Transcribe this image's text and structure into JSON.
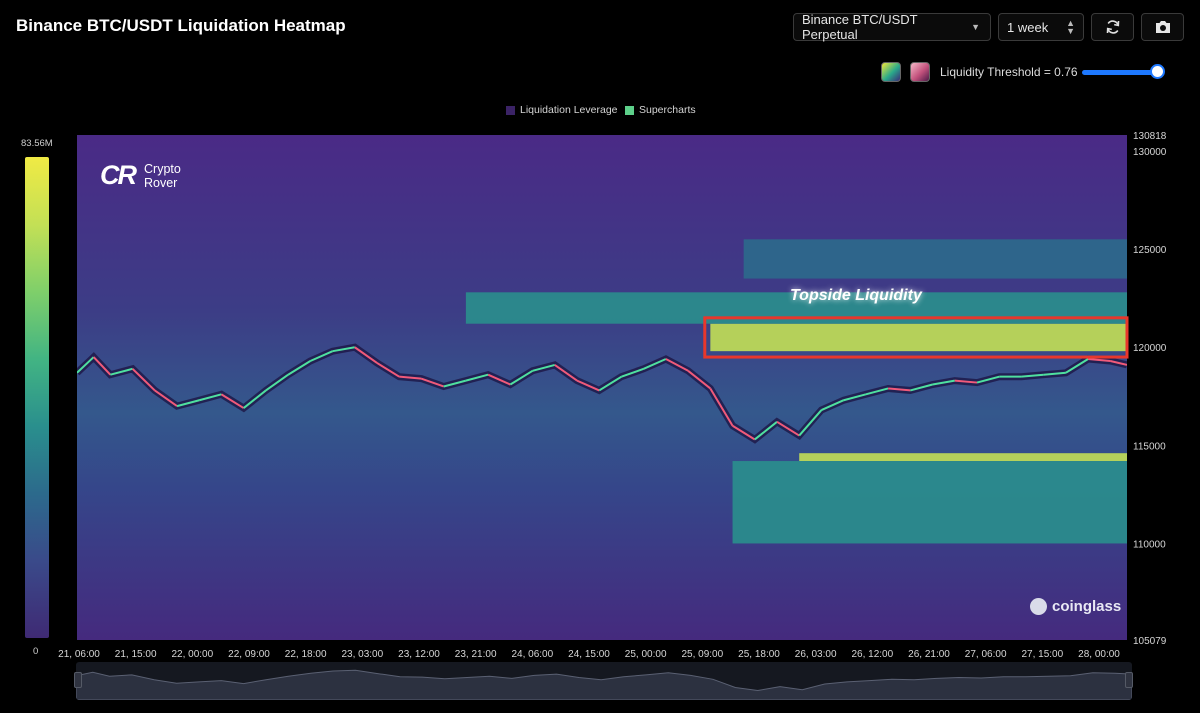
{
  "header": {
    "title": "Binance BTC/USDT Liquidation Heatmap",
    "market_select": "Binance BTC/USDT Perpetual",
    "range_select": "1 week",
    "refresh_icon": "refresh-icon",
    "camera_icon": "camera-icon"
  },
  "controls": {
    "swatch_1_colors": [
      "#f2e83a",
      "#2aa98a",
      "#3a2a78"
    ],
    "swatch_2_colors": [
      "#f6b8c8",
      "#c2517c",
      "#4c1a48"
    ],
    "threshold_label": "Liquidity Threshold = 0.76",
    "threshold_value": 0.76
  },
  "colorbar": {
    "max_label": "83.56M",
    "min_label": "0"
  },
  "branding": {
    "logo_mark": "CR",
    "logo_line1": "Crypto",
    "logo_line2": "Rover",
    "watermark": "coinglass"
  },
  "chart_data": {
    "type": "heatmap",
    "title": "Binance BTC/USDT Liquidation Heatmap",
    "legend": [
      "Liquidation Leverage",
      "Supercharts"
    ],
    "legend_colors": [
      "#3b2366",
      "#5dd08a"
    ],
    "legend_position": "top-center",
    "colorscale": [
      "#3f2a74",
      "#3a4a8a",
      "#2c6a8c",
      "#2a8f8d",
      "#42b483",
      "#7fcf6a",
      "#c3e055",
      "#f0ea44"
    ],
    "value_range": [
      0,
      83560000
    ],
    "x_tick_labels": [
      "21, 06:00",
      "21, 15:00",
      "22, 00:00",
      "22, 09:00",
      "22, 18:00",
      "23, 03:00",
      "23, 12:00",
      "23, 21:00",
      "24, 06:00",
      "24, 15:00",
      "25, 00:00",
      "25, 09:00",
      "25, 18:00",
      "26, 03:00",
      "26, 12:00",
      "26, 21:00",
      "27, 06:00",
      "27, 15:00",
      "28, 00:00"
    ],
    "x_range_hours": [
      0,
      189
    ],
    "y_tick_labels": [
      "130818",
      "130000",
      "125000",
      "120000",
      "115000",
      "110000",
      "105079"
    ],
    "ylim": [
      105079,
      130818
    ],
    "y_ticks": [
      130818,
      130000,
      125000,
      120000,
      115000,
      110000,
      105079
    ],
    "price_series": {
      "name": "BTC/USDT",
      "x_hours": [
        0,
        3,
        6,
        10,
        14,
        18,
        22,
        26,
        30,
        34,
        38,
        42,
        46,
        50,
        54,
        58,
        62,
        66,
        70,
        74,
        78,
        82,
        86,
        90,
        94,
        98,
        102,
        106,
        110,
        114,
        118,
        122,
        126,
        130,
        134,
        138,
        142,
        146,
        150,
        154,
        158,
        162,
        166,
        170,
        174,
        178,
        182,
        186,
        189
      ],
      "close": [
        118700,
        119500,
        118600,
        118900,
        117800,
        117000,
        117300,
        117600,
        116900,
        117800,
        118600,
        119300,
        119800,
        120000,
        119200,
        118500,
        118400,
        118000,
        118300,
        118600,
        118100,
        118800,
        119100,
        118300,
        117800,
        118500,
        118900,
        119400,
        118800,
        117900,
        116000,
        115300,
        116200,
        115500,
        116800,
        117300,
        117600,
        117900,
        117800,
        118100,
        118300,
        118200,
        118500,
        118500,
        118600,
        118700,
        119400,
        119300,
        119100
      ]
    },
    "liquidity_bands": [
      {
        "price_low": 119800,
        "price_high": 121200,
        "hour_start": 114,
        "hour_end": 189,
        "intensity": 0.92
      },
      {
        "price_low": 114200,
        "price_high": 114600,
        "hour_start": 130,
        "hour_end": 189,
        "intensity": 0.8
      },
      {
        "price_low": 121200,
        "price_high": 122800,
        "hour_start": 70,
        "hour_end": 189,
        "intensity": 0.45
      },
      {
        "price_low": 110000,
        "price_high": 114200,
        "hour_start": 118,
        "hour_end": 189,
        "intensity": 0.4
      },
      {
        "price_low": 123500,
        "price_high": 125500,
        "hour_start": 120,
        "hour_end": 189,
        "intensity": 0.3
      }
    ],
    "annotation": {
      "text": "Topside Liquidity",
      "price_low": 119500,
      "price_high": 121500,
      "hour_start": 113,
      "hour_end": 189,
      "box_color": "#e8372c"
    }
  }
}
